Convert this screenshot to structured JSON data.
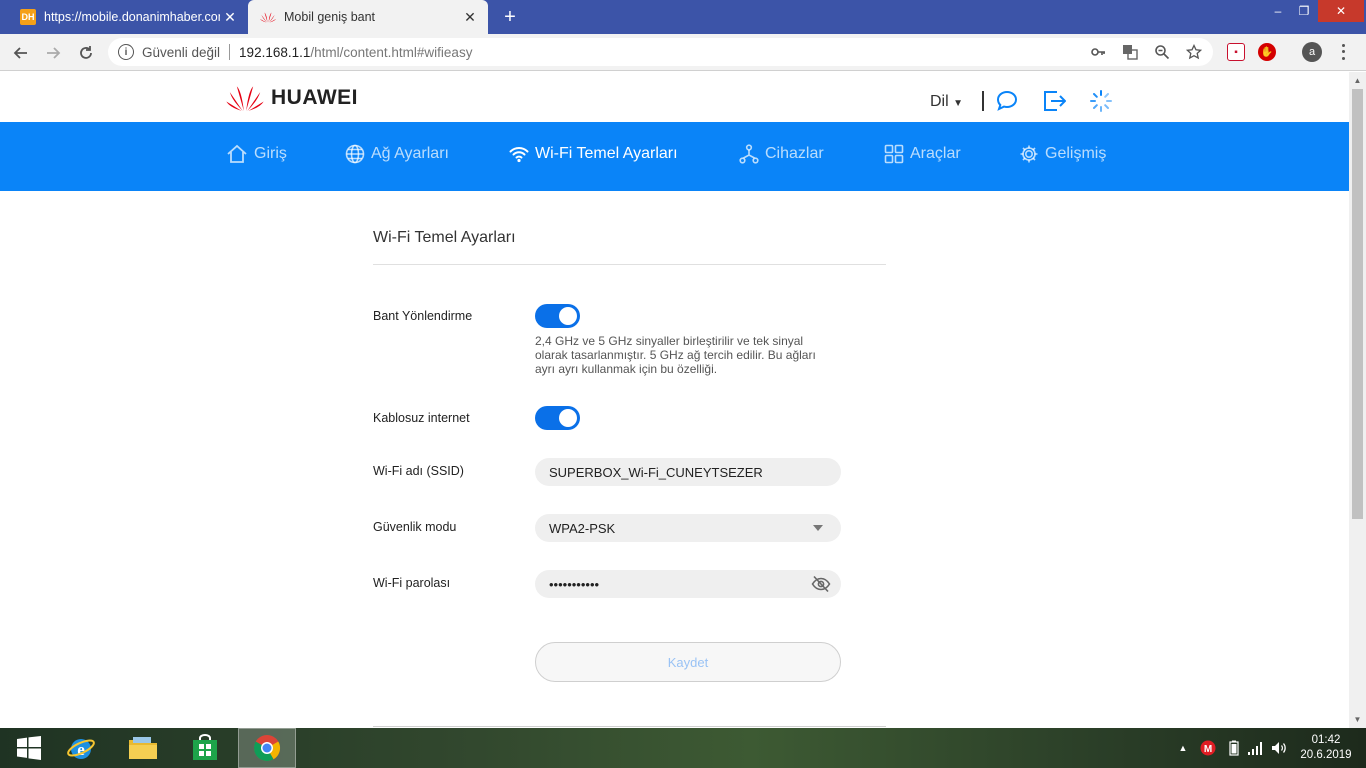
{
  "browser": {
    "tabs": [
      {
        "title": "https://mobile.donanimhaber.com",
        "favicon": "DH",
        "active": false
      },
      {
        "title": "Mobil geniş bant",
        "active": true
      }
    ],
    "address": {
      "security_label": "Güvenli değil",
      "host": "192.168.1.1",
      "path": "/html/content.html#wifieasy"
    },
    "profile_initial": "a"
  },
  "header": {
    "brand": "HUAWEI",
    "language_label": "Dil",
    "brand_color": "#e60012"
  },
  "nav": {
    "items": [
      {
        "label": "Giriş",
        "icon": "home-icon"
      },
      {
        "label": "Ağ Ayarları",
        "icon": "globe-icon"
      },
      {
        "label": "Wi-Fi Temel Ayarları",
        "icon": "wifi-icon",
        "active": true
      },
      {
        "label": "Cihazlar",
        "icon": "devices-icon"
      },
      {
        "label": "Araçlar",
        "icon": "tools-icon"
      },
      {
        "label": "Gelişmiş",
        "icon": "gear-icon"
      }
    ],
    "color": "#0a84f8"
  },
  "content": {
    "title": "Wi-Fi Temel Ayarları",
    "band_steering": {
      "label": "Bant Yönlendirme",
      "enabled": true,
      "description": "2,4 GHz ve 5 GHz sinyaller birleştirilir ve tek sinyal olarak tasarlanmıştır. 5 GHz ağ tercih edilir. Bu ağları ayrı ayrı kullanmak için bu özelliği."
    },
    "wireless": {
      "label": "Kablosuz internet",
      "enabled": true
    },
    "ssid": {
      "label": "Wi-Fi adı (SSID)",
      "value": "SUPERBOX_Wi-Fi_CUNEYTSEZER"
    },
    "security": {
      "label": "Güvenlik modu",
      "value": "WPA2-PSK"
    },
    "password": {
      "label": "Wi-Fi parolası",
      "value": "•••••••••••"
    },
    "save_label": "Kaydet"
  },
  "taskbar": {
    "clock_time": "01:42",
    "clock_date": "20.6.2019"
  }
}
